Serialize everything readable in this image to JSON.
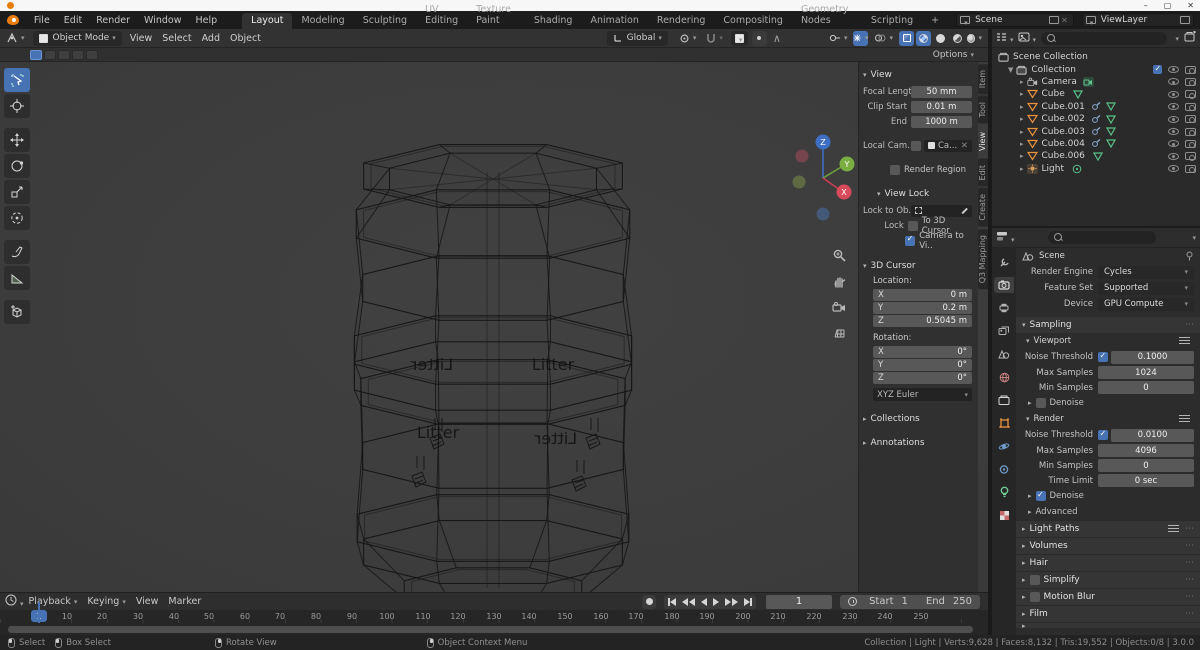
{
  "window": {
    "minimize": "–",
    "maximize": "▢",
    "close": "✕"
  },
  "menu_bar": {
    "menus": [
      "File",
      "Edit",
      "Render",
      "Window",
      "Help"
    ],
    "workspaces": [
      "Layout",
      "Modeling",
      "Sculpting",
      "UV Editing",
      "Texture Paint",
      "Shading",
      "Animation",
      "Rendering",
      "Compositing",
      "Geometry Nodes",
      "Scripting",
      "+"
    ],
    "active_workspace": "Layout",
    "scene_selector": {
      "value": "Scene"
    },
    "view_layer_selector": {
      "value": "ViewLayer"
    }
  },
  "viewport_header": {
    "mode": "Object Mode",
    "menus": [
      "View",
      "Select",
      "Add",
      "Object"
    ],
    "orientation": "Global",
    "options_label": "Options"
  },
  "viewport": {
    "gizmo": {
      "x": "X",
      "y": "Y",
      "z": "Z"
    },
    "model_text": "Litter"
  },
  "n_panel": {
    "tabs": [
      "Item",
      "Tool",
      "View",
      "Edit",
      "Create",
      "Q3 Mapping"
    ],
    "active_tab": "View",
    "view": {
      "title": "View",
      "focal_label": "Focal Lengt",
      "focal_value": "50 mm",
      "clip_start_label": "Clip Start",
      "clip_start_value": "0.01 m",
      "clip_end_label": "End",
      "clip_end_value": "1000 m",
      "local_camera_label": "Local Cam...",
      "local_camera_value": "Ca...",
      "render_region_label": "Render Region"
    },
    "view_lock": {
      "title": "View Lock",
      "lock_to_label": "Lock to Ob..",
      "lock_label": "Lock",
      "to_3d_cursor_label": "To 3D Cursor",
      "camera_to_view_label": "Camera to Vi.."
    },
    "cursor": {
      "title": "3D Cursor",
      "location_label": "Location:",
      "x": "X",
      "y": "Y",
      "z": "Z",
      "loc_x": "0 m",
      "loc_y": "0.2 m",
      "loc_z": "0.5045 m",
      "rotation_label": "Rotation:",
      "rot_x": "0°",
      "rot_y": "0°",
      "rot_z": "0°",
      "euler": "XYZ Euler"
    },
    "collections_label": "Collections",
    "annotations_label": "Annotations"
  },
  "outliner": {
    "root": "Scene Collection",
    "rows": [
      {
        "label": "Collection"
      },
      {
        "label": "Camera"
      },
      {
        "label": "Cube"
      },
      {
        "label": "Cube.001"
      },
      {
        "label": "Cube.002"
      },
      {
        "label": "Cube.003"
      },
      {
        "label": "Cube.004"
      },
      {
        "label": "Cube.006"
      },
      {
        "label": "Light"
      }
    ]
  },
  "properties": {
    "breadcrumb": "Scene",
    "render_engine_label": "Render Engine",
    "render_engine": "Cycles",
    "feature_set_label": "Feature Set",
    "feature_set": "Supported",
    "device_label": "Device",
    "device": "GPU Compute",
    "sampling": {
      "title": "Sampling",
      "viewport": {
        "title": "Viewport",
        "noise_threshold_label": "Noise Threshold",
        "noise_threshold": "0.1000",
        "max_samples_label": "Max Samples",
        "max_samples": "1024",
        "min_samples_label": "Min Samples",
        "min_samples": "0",
        "denoise_label": "Denoise"
      },
      "render": {
        "title": "Render",
        "noise_threshold_label": "Noise Threshold",
        "noise_threshold": "0.0100",
        "max_samples_label": "Max Samples",
        "max_samples": "4096",
        "min_samples_label": "Min Samples",
        "min_samples": "0",
        "time_limit_label": "Time Limit",
        "time_limit": "0 sec",
        "denoise_label": "Denoise",
        "advanced_label": "Advanced"
      }
    },
    "sections": [
      "Light Paths",
      "Volumes",
      "Hair",
      "Simplify",
      "Motion Blur",
      "Film"
    ]
  },
  "timeline": {
    "menus": [
      "Playback",
      "Keying",
      "View",
      "Marker"
    ],
    "current_frame": "1",
    "start_label": "Start",
    "start_value": "1",
    "end_label": "End",
    "end_value": "250",
    "ticks": [
      "10",
      "20",
      "30",
      "40",
      "50",
      "60",
      "70",
      "80",
      "90",
      "100",
      "110",
      "120",
      "130",
      "140",
      "150",
      "160",
      "170",
      "180",
      "190",
      "200",
      "210",
      "220",
      "230",
      "240",
      "250"
    ]
  },
  "status_bar": {
    "hints": [
      {
        "label": "Select"
      },
      {
        "label": "Box Select"
      },
      {
        "label": "Rotate View"
      },
      {
        "label": "Object Context Menu"
      }
    ],
    "info": "Collection | Light | Verts:9,628 | Faces:8,132 | Tris:19,552 | Objects:0/8 | 3.0.0"
  }
}
